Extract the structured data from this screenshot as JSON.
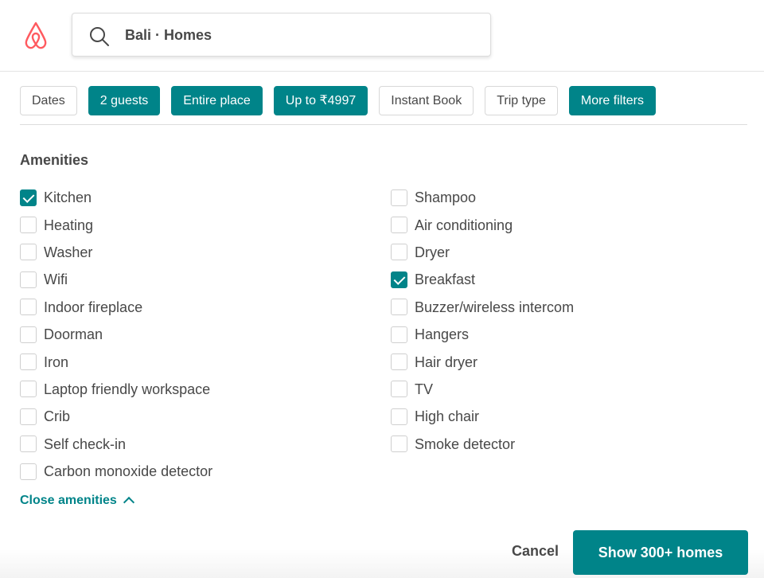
{
  "search": {
    "value": "Bali · Homes"
  },
  "filters": [
    {
      "label": "Dates",
      "active": false
    },
    {
      "label": "2 guests",
      "active": true
    },
    {
      "label": "Entire place",
      "active": true
    },
    {
      "label": "Up to ₹4997",
      "active": true
    },
    {
      "label": "Instant Book",
      "active": false
    },
    {
      "label": "Trip type",
      "active": false
    },
    {
      "label": "More filters",
      "active": true
    }
  ],
  "amenities": {
    "title": "Amenities",
    "left": [
      {
        "label": "Kitchen",
        "checked": true
      },
      {
        "label": "Heating",
        "checked": false
      },
      {
        "label": "Washer",
        "checked": false
      },
      {
        "label": "Wifi",
        "checked": false
      },
      {
        "label": "Indoor fireplace",
        "checked": false
      },
      {
        "label": "Doorman",
        "checked": false
      },
      {
        "label": "Iron",
        "checked": false
      },
      {
        "label": "Laptop friendly workspace",
        "checked": false
      },
      {
        "label": "Crib",
        "checked": false
      },
      {
        "label": "Self check-in",
        "checked": false
      },
      {
        "label": "Carbon monoxide detector",
        "checked": false
      }
    ],
    "right": [
      {
        "label": "Shampoo",
        "checked": false
      },
      {
        "label": "Air conditioning",
        "checked": false
      },
      {
        "label": "Dryer",
        "checked": false
      },
      {
        "label": "Breakfast",
        "checked": true
      },
      {
        "label": "Buzzer/wireless intercom",
        "checked": false
      },
      {
        "label": "Hangers",
        "checked": false
      },
      {
        "label": "Hair dryer",
        "checked": false
      },
      {
        "label": "TV",
        "checked": false
      },
      {
        "label": "High chair",
        "checked": false
      },
      {
        "label": "Smoke detector",
        "checked": false
      }
    ],
    "close_label": "Close amenities"
  },
  "footer": {
    "cancel_label": "Cancel",
    "primary_label": "Show 300+ homes"
  },
  "colors": {
    "accent": "#008489",
    "brand": "#FF5A5F",
    "text": "#484848"
  },
  "icons": {
    "logo": "airbnb-logo-icon",
    "search": "search-icon"
  }
}
